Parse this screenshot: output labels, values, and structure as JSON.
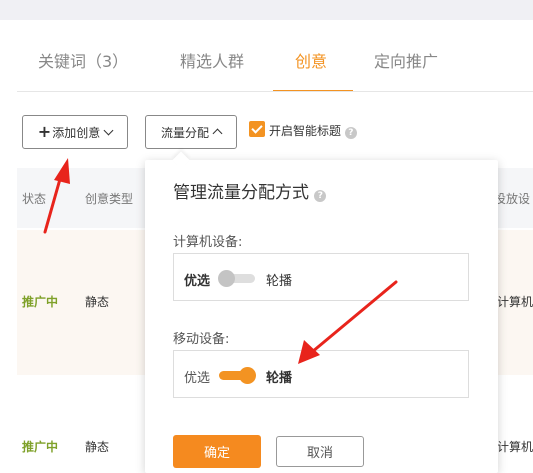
{
  "tabs": [
    {
      "label": "关键词（3）"
    },
    {
      "label": "精选人群"
    },
    {
      "label": "创意"
    },
    {
      "label": "定向推广"
    }
  ],
  "toolbar": {
    "add_creative_label": "添加创意",
    "traffic_alloc_label": "流量分配",
    "smart_title_label": "开启智能标题",
    "smart_title_checked": true
  },
  "table": {
    "headers": {
      "status": "状态",
      "creative_type": "创意类型",
      "delivery_device": "投放设"
    },
    "rows": [
      {
        "status": "推广中",
        "type": "静态",
        "device": "计算机"
      },
      {
        "status": "推广中",
        "type": "静态",
        "device": "计算机"
      }
    ]
  },
  "popover": {
    "title": "管理流量分配方式",
    "computer": {
      "label": "计算机设备:",
      "preferred": "优选",
      "rotate": "轮播",
      "rotate_enabled": false
    },
    "mobile": {
      "label": "移动设备:",
      "preferred": "优选",
      "rotate": "轮播",
      "rotate_enabled": true
    },
    "confirm_label": "确定",
    "cancel_label": "取消"
  },
  "colors": {
    "accent": "#f39322",
    "status_green": "#7fa12a",
    "annotation_red": "#e8241c"
  },
  "icons": {
    "help": "question-circle-icon",
    "dropdown": "chevron-down-icon",
    "collapse": "chevron-up-icon",
    "add": "plus-icon"
  }
}
